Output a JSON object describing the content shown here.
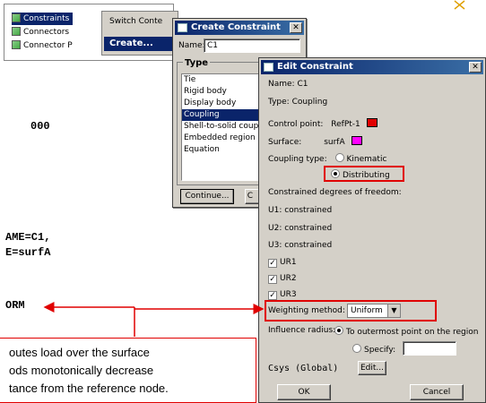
{
  "code": {
    "line1": "000",
    "line2": "AME=C1,",
    "line3": "E=surfA",
    "line4": "ORM"
  },
  "tree": {
    "items": [
      "Constraints",
      "Connectors",
      "Connector P"
    ],
    "context_menu": {
      "switch_label": "Switch Conte",
      "create_label": "Create..."
    }
  },
  "create_dialog": {
    "title": "Create Constraint",
    "name_label": "Name:",
    "name_value": "C1",
    "type_heading": "Type",
    "types": [
      "Tie",
      "Rigid body",
      "Display body",
      "Coupling",
      "Shell-to-solid couplin",
      "Embedded region",
      "Equation"
    ],
    "selected_type": "Coupling",
    "continue_label": "Continue...",
    "cancel_label": "C"
  },
  "edit_dialog": {
    "title": "Edit Constraint",
    "name_line": "Name:  C1",
    "type_line": "Type:  Coupling",
    "control_point_label": "Control point:",
    "control_point_value": "RefPt-1",
    "control_point_color": "#e00000",
    "surface_label": "Surface:",
    "surface_value": "surfA",
    "surface_color": "#ff00ff",
    "coupling_type_label": "Coupling type:",
    "coupling_kinematic": "Kinematic",
    "coupling_distributing": "Distributing",
    "dof_heading": "Constrained degrees of freedom:",
    "u1": "U1: constrained",
    "u2": "U2: constrained",
    "u3": "U3: constrained",
    "ur1": "UR1",
    "ur2": "UR2",
    "ur3": "UR3",
    "weighting_label": "Weighting method:",
    "weighting_value": "Uniform",
    "influence_label": "Influence radius:",
    "influence_option1": "To outermost point on the region",
    "influence_option2": "Specify:",
    "csys_label": "Csys (Global)",
    "edit_label": "Edit...",
    "ok_label": "OK",
    "cancel_label": "Cancel"
  },
  "annotation": {
    "line1": "outes load over the surface",
    "line2": "ods monotonically decrease",
    "line3": "tance from the reference node."
  },
  "colors": {
    "highlight_red": "#e00000",
    "title_blue": "#0a246a"
  }
}
